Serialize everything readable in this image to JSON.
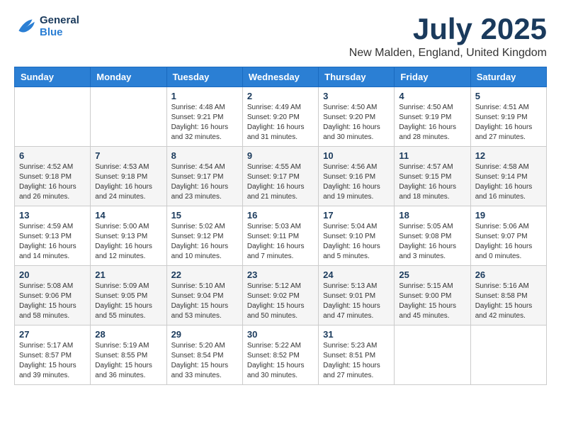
{
  "logo": {
    "line1": "General",
    "line2": "Blue"
  },
  "title": "July 2025",
  "location": "New Malden, England, United Kingdom",
  "days_of_week": [
    "Sunday",
    "Monday",
    "Tuesday",
    "Wednesday",
    "Thursday",
    "Friday",
    "Saturday"
  ],
  "weeks": [
    [
      {
        "day": "",
        "detail": ""
      },
      {
        "day": "",
        "detail": ""
      },
      {
        "day": "1",
        "detail": "Sunrise: 4:48 AM\nSunset: 9:21 PM\nDaylight: 16 hours and 32 minutes."
      },
      {
        "day": "2",
        "detail": "Sunrise: 4:49 AM\nSunset: 9:20 PM\nDaylight: 16 hours and 31 minutes."
      },
      {
        "day": "3",
        "detail": "Sunrise: 4:50 AM\nSunset: 9:20 PM\nDaylight: 16 hours and 30 minutes."
      },
      {
        "day": "4",
        "detail": "Sunrise: 4:50 AM\nSunset: 9:19 PM\nDaylight: 16 hours and 28 minutes."
      },
      {
        "day": "5",
        "detail": "Sunrise: 4:51 AM\nSunset: 9:19 PM\nDaylight: 16 hours and 27 minutes."
      }
    ],
    [
      {
        "day": "6",
        "detail": "Sunrise: 4:52 AM\nSunset: 9:18 PM\nDaylight: 16 hours and 26 minutes."
      },
      {
        "day": "7",
        "detail": "Sunrise: 4:53 AM\nSunset: 9:18 PM\nDaylight: 16 hours and 24 minutes."
      },
      {
        "day": "8",
        "detail": "Sunrise: 4:54 AM\nSunset: 9:17 PM\nDaylight: 16 hours and 23 minutes."
      },
      {
        "day": "9",
        "detail": "Sunrise: 4:55 AM\nSunset: 9:17 PM\nDaylight: 16 hours and 21 minutes."
      },
      {
        "day": "10",
        "detail": "Sunrise: 4:56 AM\nSunset: 9:16 PM\nDaylight: 16 hours and 19 minutes."
      },
      {
        "day": "11",
        "detail": "Sunrise: 4:57 AM\nSunset: 9:15 PM\nDaylight: 16 hours and 18 minutes."
      },
      {
        "day": "12",
        "detail": "Sunrise: 4:58 AM\nSunset: 9:14 PM\nDaylight: 16 hours and 16 minutes."
      }
    ],
    [
      {
        "day": "13",
        "detail": "Sunrise: 4:59 AM\nSunset: 9:13 PM\nDaylight: 16 hours and 14 minutes."
      },
      {
        "day": "14",
        "detail": "Sunrise: 5:00 AM\nSunset: 9:13 PM\nDaylight: 16 hours and 12 minutes."
      },
      {
        "day": "15",
        "detail": "Sunrise: 5:02 AM\nSunset: 9:12 PM\nDaylight: 16 hours and 10 minutes."
      },
      {
        "day": "16",
        "detail": "Sunrise: 5:03 AM\nSunset: 9:11 PM\nDaylight: 16 hours and 7 minutes."
      },
      {
        "day": "17",
        "detail": "Sunrise: 5:04 AM\nSunset: 9:10 PM\nDaylight: 16 hours and 5 minutes."
      },
      {
        "day": "18",
        "detail": "Sunrise: 5:05 AM\nSunset: 9:08 PM\nDaylight: 16 hours and 3 minutes."
      },
      {
        "day": "19",
        "detail": "Sunrise: 5:06 AM\nSunset: 9:07 PM\nDaylight: 16 hours and 0 minutes."
      }
    ],
    [
      {
        "day": "20",
        "detail": "Sunrise: 5:08 AM\nSunset: 9:06 PM\nDaylight: 15 hours and 58 minutes."
      },
      {
        "day": "21",
        "detail": "Sunrise: 5:09 AM\nSunset: 9:05 PM\nDaylight: 15 hours and 55 minutes."
      },
      {
        "day": "22",
        "detail": "Sunrise: 5:10 AM\nSunset: 9:04 PM\nDaylight: 15 hours and 53 minutes."
      },
      {
        "day": "23",
        "detail": "Sunrise: 5:12 AM\nSunset: 9:02 PM\nDaylight: 15 hours and 50 minutes."
      },
      {
        "day": "24",
        "detail": "Sunrise: 5:13 AM\nSunset: 9:01 PM\nDaylight: 15 hours and 47 minutes."
      },
      {
        "day": "25",
        "detail": "Sunrise: 5:15 AM\nSunset: 9:00 PM\nDaylight: 15 hours and 45 minutes."
      },
      {
        "day": "26",
        "detail": "Sunrise: 5:16 AM\nSunset: 8:58 PM\nDaylight: 15 hours and 42 minutes."
      }
    ],
    [
      {
        "day": "27",
        "detail": "Sunrise: 5:17 AM\nSunset: 8:57 PM\nDaylight: 15 hours and 39 minutes."
      },
      {
        "day": "28",
        "detail": "Sunrise: 5:19 AM\nSunset: 8:55 PM\nDaylight: 15 hours and 36 minutes."
      },
      {
        "day": "29",
        "detail": "Sunrise: 5:20 AM\nSunset: 8:54 PM\nDaylight: 15 hours and 33 minutes."
      },
      {
        "day": "30",
        "detail": "Sunrise: 5:22 AM\nSunset: 8:52 PM\nDaylight: 15 hours and 30 minutes."
      },
      {
        "day": "31",
        "detail": "Sunrise: 5:23 AM\nSunset: 8:51 PM\nDaylight: 15 hours and 27 minutes."
      },
      {
        "day": "",
        "detail": ""
      },
      {
        "day": "",
        "detail": ""
      }
    ]
  ]
}
